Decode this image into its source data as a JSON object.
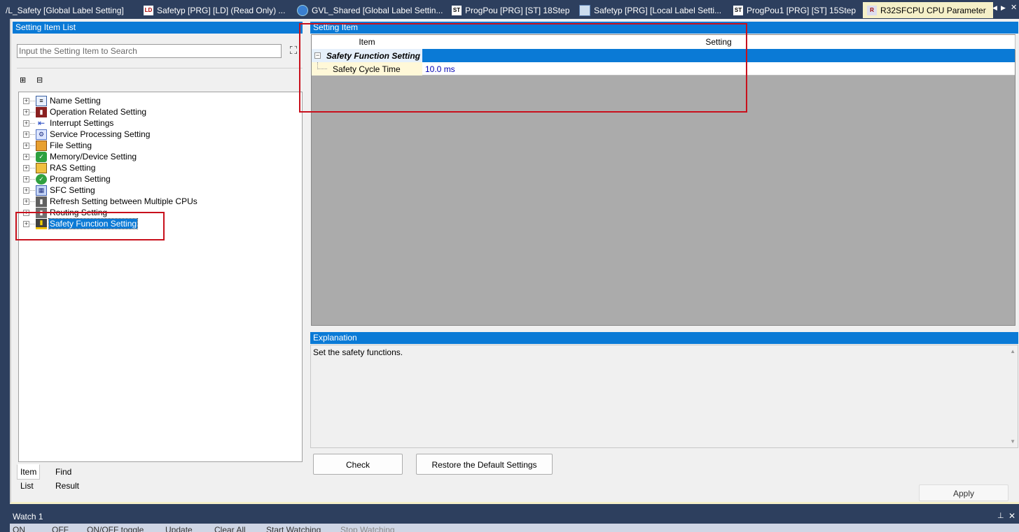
{
  "tabs": [
    {
      "label": "/L_Safety [Global Label Setting]",
      "icon": "grid-icon"
    },
    {
      "label": "Safetyp [PRG] [LD] (Read Only) ...",
      "icon": "ld-icon"
    },
    {
      "label": "GVL_Shared [Global Label Settin...",
      "icon": "globe-icon"
    },
    {
      "label": "ProgPou [PRG] [ST] 18Step",
      "icon": "st-icon"
    },
    {
      "label": "Safetyp [PRG] [Local Label Setti...",
      "icon": "grid-icon"
    },
    {
      "label": "ProgPou1 [PRG] [ST] 15Step",
      "icon": "st-icon"
    },
    {
      "label": "R32SFCPU CPU Parameter",
      "icon": "parameter-icon",
      "active": true
    }
  ],
  "left": {
    "header": "Setting Item List",
    "search_placeholder": "Input the Setting Item to Search",
    "tree": [
      {
        "label": "Name Setting",
        "icon": "name-setting-icon"
      },
      {
        "label": "Operation Related Setting",
        "icon": "operation-icon"
      },
      {
        "label": "Interrupt Settings",
        "icon": "interrupt-icon"
      },
      {
        "label": "Service Processing Setting",
        "icon": "service-icon"
      },
      {
        "label": "File Setting",
        "icon": "file-icon"
      },
      {
        "label": "Memory/Device Setting",
        "icon": "memory-icon"
      },
      {
        "label": "RAS Setting",
        "icon": "ras-icon"
      },
      {
        "label": "Program Setting",
        "icon": "program-icon"
      },
      {
        "label": "SFC Setting",
        "icon": "sfc-icon"
      },
      {
        "label": "Refresh Setting between Multiple CPUs",
        "icon": "refresh-icon"
      },
      {
        "label": "Routing Setting",
        "icon": "routing-icon"
      },
      {
        "label": "Safety Function Setting",
        "icon": "safety-icon",
        "selected": true
      }
    ],
    "bottom_tabs": [
      "Item List",
      "Find Result"
    ]
  },
  "right": {
    "header": "Setting Item",
    "columns": [
      "Item",
      "Setting"
    ],
    "group": "Safety Function Setting",
    "rows": [
      {
        "item": "Safety Cycle Time",
        "setting": "10.0 ms"
      }
    ],
    "explanation_header": "Explanation",
    "explanation": "Set the safety functions."
  },
  "buttons": {
    "check": "Check",
    "restore": "Restore the Default Settings",
    "apply": "Apply"
  },
  "watch": {
    "title": "Watch 1",
    "toolbar": [
      "ON",
      "OFF",
      "ON/OFF toggle",
      "Update",
      "Clear All",
      "Start Watching",
      "Stop Watching"
    ]
  },
  "colors": {
    "accent": "#0a7ad6",
    "annotation": "#c8101c",
    "frame": "#2d3f5e"
  }
}
